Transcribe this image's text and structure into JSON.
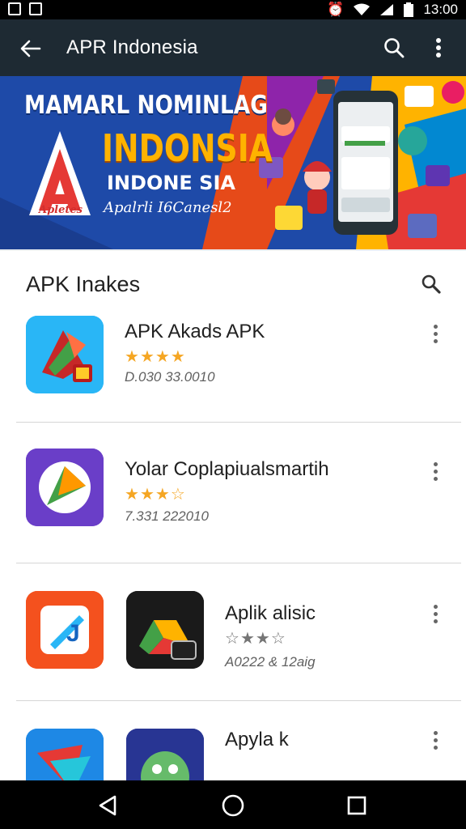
{
  "status_bar": {
    "time": "13:00"
  },
  "app_bar": {
    "title": "APR Indonesia"
  },
  "banner": {
    "headline": "MAMARL NOMINLAG",
    "big": "INDONSIA",
    "sub": "INDONE SIA",
    "tagline": "Apalrli I6Canesl2",
    "logo_text": "Apletes"
  },
  "section": {
    "title": "APK Inakes"
  },
  "apps": [
    {
      "name": "APK Akads APK",
      "meta": "D.030 33.0010"
    },
    {
      "name": "Yolar Coplapiualsmartih",
      "meta": "7.331 222010"
    },
    {
      "name": "Aplik alisic",
      "meta": "A0222 & 12aig"
    },
    {
      "name": "Apyla k",
      "meta": ""
    }
  ],
  "icons": {
    "back": "arrow-back-icon",
    "search": "search-icon",
    "more": "more-vert-icon",
    "nav_back": "triangle-back-icon",
    "nav_home": "circle-home-icon",
    "nav_recents": "square-recents-icon"
  },
  "colors": {
    "app_bar": "#1e2a33",
    "star": "#f5a623",
    "banner": "#1e4aa8",
    "accent_orange": "#ffb300"
  }
}
